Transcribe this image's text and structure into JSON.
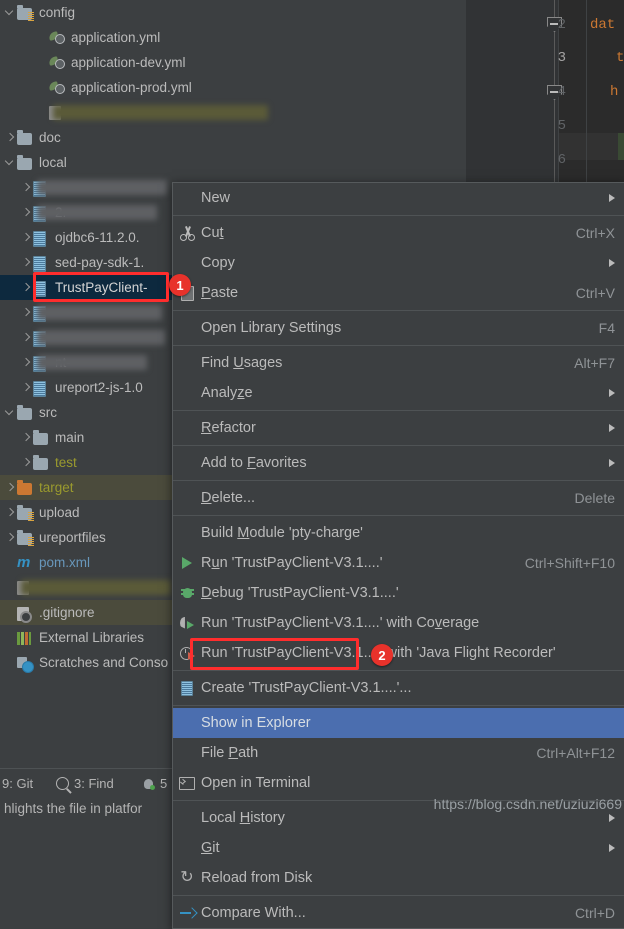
{
  "app": {
    "title": "IntelliJ IDEA Project View with Context Menu"
  },
  "project_tree": {
    "rows": [
      {
        "indent": 0,
        "twisty": "down",
        "icon": "folder-module-icon",
        "label": "config",
        "style": "normal",
        "blurred": false
      },
      {
        "indent": 2,
        "twisty": "none",
        "icon": "yaml-file-icon",
        "label": "application.yml",
        "style": "normal",
        "blurred": false
      },
      {
        "indent": 2,
        "twisty": "none",
        "icon": "yaml-file-icon",
        "label": "application-dev.yml",
        "style": "normal",
        "blurred": false
      },
      {
        "indent": 2,
        "twisty": "none",
        "icon": "yaml-file-icon",
        "label": "application-prod.yml",
        "style": "normal",
        "blurred": false
      },
      {
        "indent": 2,
        "twisty": "none",
        "icon": "file-icon",
        "label": "",
        "style": "normal",
        "blurred": true,
        "blur_color": "#5a5a38",
        "blur_width": 215
      },
      {
        "indent": 0,
        "twisty": "right",
        "icon": "folder-icon",
        "label": "doc",
        "style": "normal",
        "blurred": false
      },
      {
        "indent": 0,
        "twisty": "down",
        "icon": "folder-icon",
        "label": "local",
        "style": "normal",
        "blurred": false
      },
      {
        "indent": 1,
        "twisty": "right",
        "icon": "jar-icon",
        "label": "",
        "style": "normal",
        "blurred": true,
        "blur_color": "#5e6063",
        "blur_width": 130
      },
      {
        "indent": 1,
        "twisty": "right",
        "icon": "jar-icon",
        "label": "2.",
        "style": "normal",
        "blurred": true,
        "blur_color": "#5e6063",
        "blur_width": 120
      },
      {
        "indent": 1,
        "twisty": "right",
        "icon": "jar-icon",
        "label": "ojdbc6-11.2.0.",
        "style": "normal",
        "blurred": false
      },
      {
        "indent": 1,
        "twisty": "right",
        "icon": "jar-icon",
        "label": "sed-pay-sdk-1.",
        "style": "normal",
        "blurred": false
      },
      {
        "indent": 1,
        "twisty": "right",
        "icon": "jar-icon",
        "label": "TrustPayClient-",
        "style": "selected",
        "blurred": false
      },
      {
        "indent": 1,
        "twisty": "right",
        "icon": "jar-icon",
        "label": "",
        "style": "normal",
        "blurred": true,
        "blur_color": "#5e6063",
        "blur_width": 125
      },
      {
        "indent": 1,
        "twisty": "right",
        "icon": "jar-icon",
        "label": "",
        "style": "normal",
        "blurred": true,
        "blur_color": "#5e6063",
        "blur_width": 128
      },
      {
        "indent": 1,
        "twisty": "right",
        "icon": "jar-icon",
        "label": "nt-",
        "style": "normal",
        "blurred": true,
        "blur_color": "#5e6063",
        "blur_width": 110
      },
      {
        "indent": 1,
        "twisty": "right",
        "icon": "jar-icon",
        "label": "ureport2-js-1.0",
        "style": "normal",
        "blurred": false
      },
      {
        "indent": 0,
        "twisty": "down",
        "icon": "folder-icon",
        "label": "src",
        "style": "normal",
        "blurred": false
      },
      {
        "indent": 1,
        "twisty": "right",
        "icon": "folder-icon",
        "label": "main",
        "style": "normal",
        "blurred": false
      },
      {
        "indent": 1,
        "twisty": "right",
        "icon": "folder-icon",
        "label": "test",
        "style": "test",
        "blurred": false
      },
      {
        "indent": 0,
        "twisty": "right",
        "icon": "folder-excluded-icon",
        "label": "target",
        "style": "target",
        "blurred": false
      },
      {
        "indent": 0,
        "twisty": "right",
        "icon": "folder-module-icon",
        "label": "upload",
        "style": "normal",
        "blurred": false
      },
      {
        "indent": 0,
        "twisty": "right",
        "icon": "folder-module-icon",
        "label": "ureportfiles",
        "style": "normal",
        "blurred": false
      },
      {
        "indent": 0,
        "twisty": "none",
        "icon": "maven-icon",
        "label": "pom.xml",
        "style": "link",
        "blurred": false
      },
      {
        "indent": 0,
        "twisty": "none",
        "icon": "file-icon",
        "label": "",
        "style": "normal",
        "blurred": true,
        "blur_color": "#5a5a38",
        "blur_width": 150
      },
      {
        "indent": 0,
        "twisty": "none",
        "icon": "gitignore-icon",
        "label": ".gitignore",
        "style": "ctxrow",
        "blurred": false
      },
      {
        "indent": 0,
        "twisty": "none",
        "icon": "external-libraries-icon",
        "label": "External Libraries",
        "style": "normal",
        "blurred": false
      },
      {
        "indent": 0,
        "twisty": "none",
        "icon": "scratches-icon",
        "label": "Scratches and Conso",
        "style": "normal",
        "blurred": false
      }
    ]
  },
  "editor": {
    "line_numbers": [
      "2",
      "3",
      "4",
      "5",
      "6"
    ],
    "current_line": "3",
    "code_fragments": [
      "dat",
      "t",
      "h"
    ]
  },
  "context_menu": {
    "items": [
      {
        "label": "New",
        "accel": "",
        "icon": "",
        "submenu": true,
        "sep_after": true
      },
      {
        "label": "Cut",
        "accel": "Ctrl+X",
        "icon": "cut-icon",
        "submenu": false,
        "sep_after": false,
        "mnemonic": "t"
      },
      {
        "label": "Copy",
        "accel": "",
        "icon": "",
        "submenu": true,
        "sep_after": false
      },
      {
        "label": "Paste",
        "accel": "Ctrl+V",
        "icon": "paste-icon",
        "submenu": false,
        "sep_after": true,
        "mnemonic": "P"
      },
      {
        "label": "Open Library Settings",
        "accel": "F4",
        "icon": "",
        "submenu": false,
        "sep_after": true
      },
      {
        "label": "Find Usages",
        "accel": "Alt+F7",
        "icon": "",
        "submenu": false,
        "sep_after": false,
        "mnemonic": "U"
      },
      {
        "label": "Analyze",
        "accel": "",
        "icon": "",
        "submenu": true,
        "sep_after": true,
        "mnemonic": "z"
      },
      {
        "label": "Refactor",
        "accel": "",
        "icon": "",
        "submenu": true,
        "sep_after": true,
        "mnemonic": "R"
      },
      {
        "label": "Add to Favorites",
        "accel": "",
        "icon": "",
        "submenu": true,
        "sep_after": true,
        "mnemonic": "F"
      },
      {
        "label": "Delete...",
        "accel": "Delete",
        "icon": "",
        "submenu": false,
        "sep_after": true,
        "mnemonic": "D"
      },
      {
        "label": "Build Module 'pty-charge'",
        "accel": "",
        "icon": "",
        "submenu": false,
        "sep_after": false,
        "mnemonic": "M"
      },
      {
        "label": "Run 'TrustPayClient-V3.1....'",
        "accel": "Ctrl+Shift+F10",
        "icon": "run-icon",
        "submenu": false,
        "sep_after": false,
        "mnemonic": "u"
      },
      {
        "label": "Debug 'TrustPayClient-V3.1....'",
        "accel": "",
        "icon": "debug-icon",
        "submenu": false,
        "sep_after": false,
        "mnemonic": "D"
      },
      {
        "label": "Run 'TrustPayClient-V3.1....' with Coverage",
        "accel": "",
        "icon": "coverage-icon",
        "submenu": false,
        "sep_after": false,
        "mnemonic": "v"
      },
      {
        "label": "Run 'TrustPayClient-V3.1....' with 'Java Flight Recorder'",
        "accel": "",
        "icon": "jfr-icon",
        "submenu": false,
        "sep_after": true
      },
      {
        "label": "Create 'TrustPayClient-V3.1....'...",
        "accel": "",
        "icon": "create-jar-icon",
        "submenu": false,
        "sep_after": true
      },
      {
        "label": "Show in Explorer",
        "accel": "",
        "icon": "",
        "submenu": false,
        "sep_after": false,
        "highlighted": true
      },
      {
        "label": "File Path",
        "accel": "Ctrl+Alt+F12",
        "icon": "",
        "submenu": false,
        "sep_after": false,
        "mnemonic": "P"
      },
      {
        "label": "Open in Terminal",
        "accel": "",
        "icon": "terminal-icon",
        "submenu": false,
        "sep_after": true
      },
      {
        "label": "Local History",
        "accel": "",
        "icon": "",
        "submenu": true,
        "sep_after": false,
        "mnemonic": "H"
      },
      {
        "label": "Git",
        "accel": "",
        "icon": "",
        "submenu": true,
        "sep_after": false,
        "mnemonic": "G"
      },
      {
        "label": "Reload from Disk",
        "accel": "",
        "icon": "reload-icon",
        "submenu": false,
        "sep_after": true
      },
      {
        "label": "Compare With...",
        "accel": "Ctrl+D",
        "icon": "compare-icon",
        "submenu": false,
        "sep_after": false
      }
    ]
  },
  "annotations": [
    {
      "badge": "1",
      "target": "TrustPayClient-"
    },
    {
      "badge": "2",
      "target": "Show in Explorer"
    }
  ],
  "status_bar": {
    "items": [
      {
        "label": "9: Git",
        "icon": ""
      },
      {
        "label": "3: Find",
        "icon": "search-icon"
      },
      {
        "label": "5",
        "icon": "debug-status-icon"
      }
    ],
    "hint": "hlights the file in platfor"
  },
  "watermark": "https://blog.csdn.net/uziuzi669",
  "colors": {
    "background": "#3c3f41",
    "editor_background": "#2b2b2b",
    "selection_blue": "#4b6eaf",
    "tree_selection": "#0d293e",
    "annotation_red": "#ff2d2d",
    "badge_red": "#e8322b",
    "text": "#bbbbbb",
    "accel_text": "#8f9396",
    "target_folder": "#9a9a2e",
    "link_blue": "#6897bb",
    "run_green": "#59a869"
  }
}
